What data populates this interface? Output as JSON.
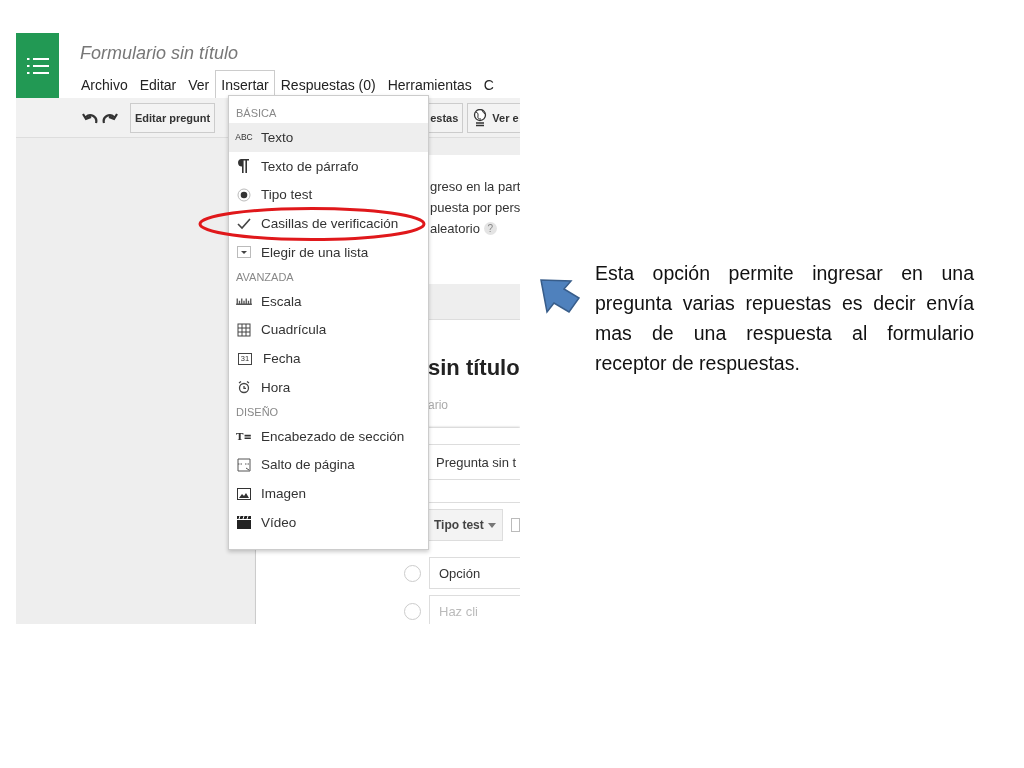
{
  "app": {
    "title": "Formulario sin título"
  },
  "menubar": [
    {
      "label": "Archivo",
      "selected": false
    },
    {
      "label": "Editar",
      "selected": false
    },
    {
      "label": "Ver",
      "selected": false
    },
    {
      "label": "Insertar",
      "selected": true
    },
    {
      "label": "Respuestas (0)",
      "selected": false
    },
    {
      "label": "Herramientas",
      "selected": false
    },
    {
      "label": "C",
      "selected": false
    }
  ],
  "toolbar": {
    "edit_button": "Editar pregunt",
    "responses_button": "estas",
    "view_button": "Ver e"
  },
  "settings_card": {
    "lines": [
      "greso en la part",
      "puesta por pers",
      "aleatorio"
    ],
    "help": "?"
  },
  "form": {
    "title": "sin título",
    "description": "ario"
  },
  "question": {
    "title_field": "Pregunta sin t",
    "type_button": "Tipo test",
    "checkbox_checked": false,
    "options": [
      {
        "value": "Opción",
        "placeholder": false,
        "selected": false
      },
      {
        "value": "Haz cli",
        "placeholder": true,
        "selected": false
      }
    ]
  },
  "insert_menu": [
    {
      "title": "BÁSICA",
      "items": [
        {
          "label": "Texto",
          "icon_text": "ABC",
          "selected": true,
          "circled": false
        },
        {
          "label": "Texto de párrafo",
          "selected": false,
          "circled": false
        },
        {
          "label": "Tipo test",
          "selected": false,
          "circled": false
        },
        {
          "label": "Casillas de verificación",
          "selected": false,
          "circled": true
        },
        {
          "label": "Elegir de una lista",
          "selected": false,
          "circled": false
        }
      ]
    },
    {
      "title": "AVANZADA",
      "items": [
        {
          "label": "Escala",
          "selected": false,
          "circled": false
        },
        {
          "label": "Cuadrícula",
          "selected": false,
          "circled": false
        },
        {
          "label": "Fecha",
          "icon_text": "31",
          "selected": false,
          "circled": false
        },
        {
          "label": "Hora",
          "selected": false,
          "circled": false
        }
      ]
    },
    {
      "title": "DISEÑO",
      "items": [
        {
          "label": "Encabezado de sección",
          "icon_text": "T≡",
          "selected": false,
          "circled": false
        },
        {
          "label": "Salto de página",
          "selected": false,
          "circled": false
        },
        {
          "label": "Imagen",
          "selected": false,
          "circled": false
        },
        {
          "label": "Vídeo",
          "selected": false,
          "circled": false
        }
      ]
    }
  ],
  "annotation": {
    "text": "Esta opción permite ingresar en una pregunta varias repuestas es decir envía mas de una respuesta al formulario receptor de respuestas."
  }
}
